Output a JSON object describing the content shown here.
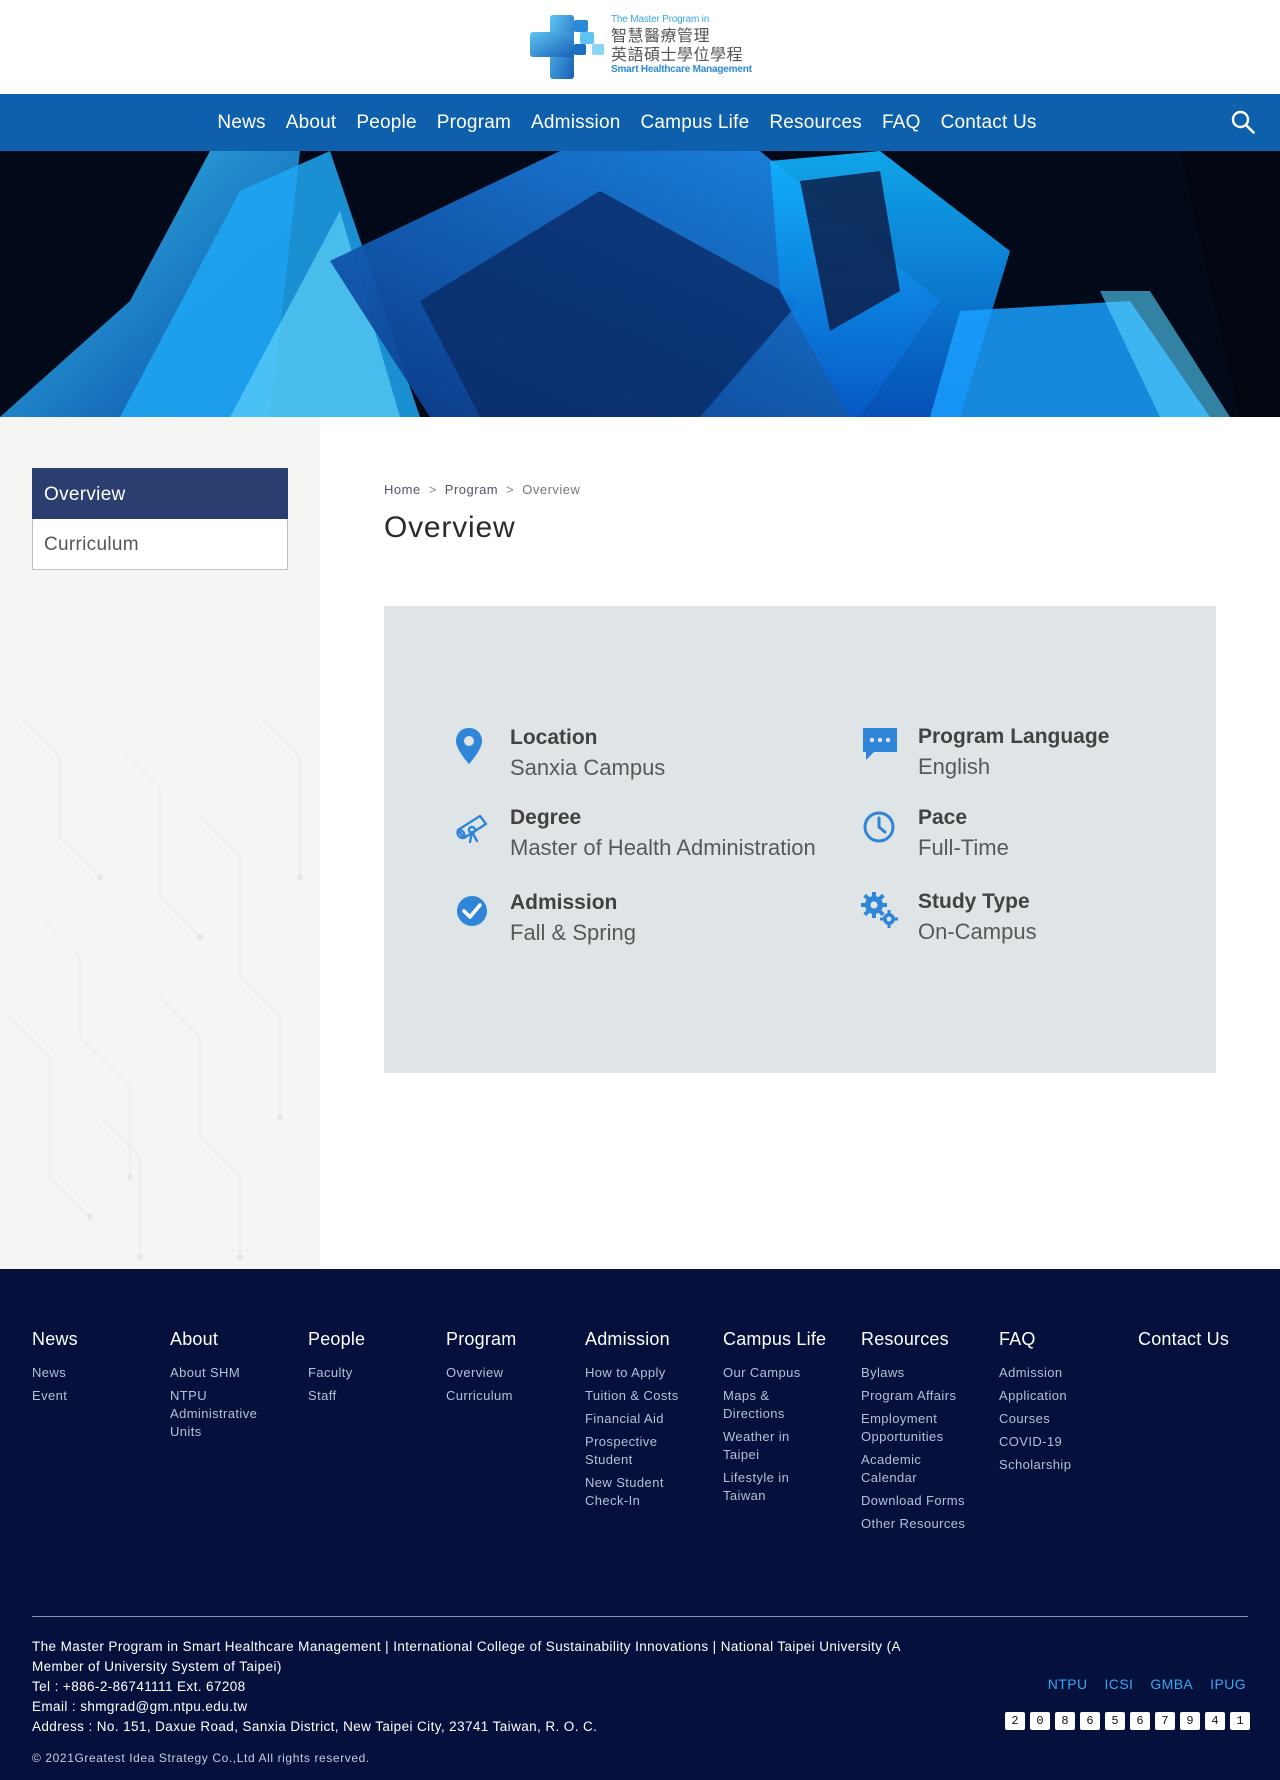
{
  "logo": {
    "en_top": "The Master Program in",
    "zh_line1": "智慧醫療管理",
    "zh_line2": "英語碩士學位學程",
    "en_bottom": "Smart Healthcare Management"
  },
  "nav": {
    "items": [
      {
        "label": "News"
      },
      {
        "label": "About"
      },
      {
        "label": "People"
      },
      {
        "label": "Program"
      },
      {
        "label": "Admission"
      },
      {
        "label": "Campus Life"
      },
      {
        "label": "Resources"
      },
      {
        "label": "FAQ"
      },
      {
        "label": "Contact Us"
      }
    ],
    "search_icon": "search-icon"
  },
  "sidebar": {
    "items": [
      {
        "label": "Overview",
        "active": true
      },
      {
        "label": "Curriculum",
        "active": false
      }
    ]
  },
  "breadcrumb": {
    "home": "Home",
    "section": "Program",
    "current": "Overview",
    "separator": ">"
  },
  "page": {
    "title": "Overview"
  },
  "overview": {
    "items": [
      {
        "label": "Location",
        "value": "Sanxia Campus",
        "icon": "map-pin-icon"
      },
      {
        "label": "Program Language",
        "value": "English",
        "icon": "chat-bubble-icon"
      },
      {
        "label": "Degree",
        "value": "Master of Health Administration",
        "icon": "diploma-icon"
      },
      {
        "label": "Pace",
        "value": "Full-Time",
        "icon": "clock-icon"
      },
      {
        "label": "Admission",
        "value": "Fall & Spring",
        "icon": "check-circle-icon"
      },
      {
        "label": "Study Type",
        "value": "On-Campus",
        "icon": "gears-icon"
      }
    ]
  },
  "footer": {
    "columns": [
      {
        "heading": "News",
        "links": [
          "News",
          "Event"
        ]
      },
      {
        "heading": "About",
        "links": [
          "About SHM",
          "NTPU Administrative Units"
        ]
      },
      {
        "heading": "People",
        "links": [
          "Faculty",
          "Staff"
        ]
      },
      {
        "heading": "Program",
        "links": [
          "Overview",
          "Curriculum"
        ]
      },
      {
        "heading": "Admission",
        "links": [
          "How to Apply",
          "Tuition & Costs",
          "Financial Aid",
          "Prospective Student",
          "New Student Check-In"
        ]
      },
      {
        "heading": "Campus Life",
        "links": [
          "Our Campus",
          "Maps & Directions",
          "Weather in Taipei",
          "Lifestyle in Taiwan"
        ]
      },
      {
        "heading": "Resources",
        "links": [
          "Bylaws",
          "Program Affairs",
          "Employment Opportunities",
          "Academic Calendar",
          "Download Forms",
          "Other Resources"
        ]
      },
      {
        "heading": "FAQ",
        "links": [
          "Admission",
          "Application",
          "Courses",
          "COVID-19",
          "Scholarship"
        ]
      },
      {
        "heading": "Contact Us",
        "links": []
      }
    ],
    "info": {
      "line1": "The Master Program in Smart Healthcare Management | International College of Sustainability Innovations | National Taipei University (A Member of University System of Taipei)",
      "tel": "Tel : +886-2-86741111 Ext. 67208",
      "email": "Email : shmgrad@gm.ntpu.edu.tw",
      "address": "Address : No. 151, Daxue Road, Sanxia District, New Taipei City, 23741 Taiwan, R. O. C."
    },
    "copyright": "© 2021Greatest Idea Strategy Co.,Ltd All rights reserved.",
    "partners": [
      "NTPU",
      "ICSI",
      "GMBA",
      "IPUG"
    ],
    "visitor_counter": [
      "2",
      "0",
      "8",
      "6",
      "5",
      "6",
      "7",
      "9",
      "4",
      "1"
    ]
  },
  "colors": {
    "nav_bg": "#0e60ad",
    "sidebar_active": "#2a3e6f",
    "footer_bg": "#05103c",
    "icon_blue": "#2f85d8",
    "card_bg": "#dfe5e6"
  }
}
